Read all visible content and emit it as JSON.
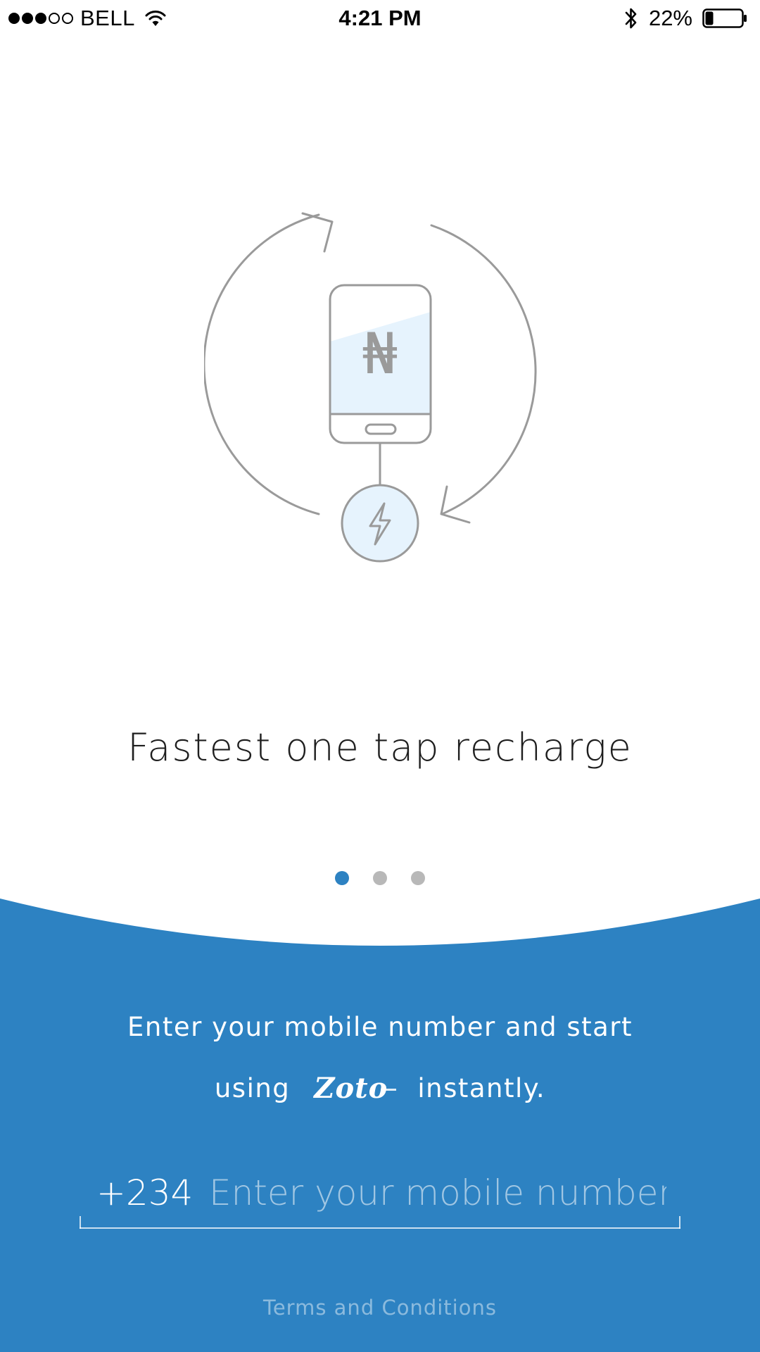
{
  "status_bar": {
    "carrier": "BELL",
    "signal_bars_filled": 3,
    "signal_bars_total": 5,
    "time": "4:21 PM",
    "battery_percent": "22%",
    "battery_level": 0.22,
    "icons": [
      "wifi-icon",
      "bluetooth-icon",
      "battery-icon"
    ]
  },
  "slide": {
    "title": "Fastest one tap recharge",
    "currency_symbol": "₦",
    "illustration_icons": [
      "phone-icon",
      "refresh-arrows-icon",
      "lightning-bolt-icon"
    ],
    "pager": {
      "total": 3,
      "active_index": 0
    }
  },
  "signup": {
    "intro_line_1": "Enter your mobile number and start",
    "intro_using": "using",
    "brand_name": "Zoto",
    "intro_instantly": "instantly.",
    "country_code": "+234",
    "phone_placeholder": "Enter your mobile number",
    "phone_value": "",
    "terms_label": "Terms and Conditions"
  },
  "colors": {
    "accent_blue": "#2d82c2",
    "pager_inactive": "#b8b8b8",
    "illustration_stroke": "#9a9a9a",
    "illustration_fill": "#e6f3fd",
    "background": "#ffffff"
  }
}
